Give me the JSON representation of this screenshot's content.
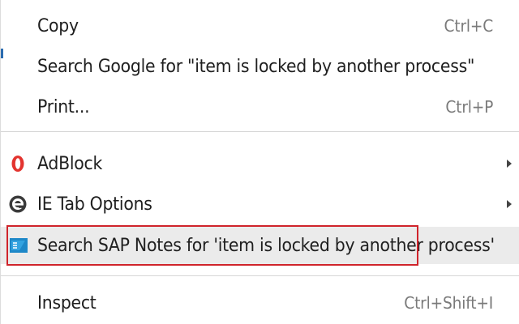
{
  "menu": {
    "items": [
      {
        "label": "Copy",
        "shortcut": "Ctrl+C"
      },
      {
        "label": "Search Google for \"item is locked by another process\"",
        "shortcut": ""
      },
      {
        "label": "Print...",
        "shortcut": "Ctrl+P"
      },
      {
        "label": "AdBlock",
        "shortcut": "",
        "icon": "adblock-icon",
        "submenu": true
      },
      {
        "label": "IE Tab Options",
        "shortcut": "",
        "icon": "ie-tab-icon",
        "submenu": true
      },
      {
        "label": "Search SAP Notes for 'item is locked by another process'",
        "shortcut": "",
        "icon": "sap-icon",
        "highlighted": true
      },
      {
        "label": "Inspect",
        "shortcut": "Ctrl+Shift+I"
      }
    ]
  },
  "colors": {
    "highlight_border": "#d0242b",
    "hover_background": "#ebebeb",
    "adblock_red": "#e3342f",
    "ie_tab_dark": "#3a3a3a",
    "sap_blue": "#1e88c8"
  }
}
